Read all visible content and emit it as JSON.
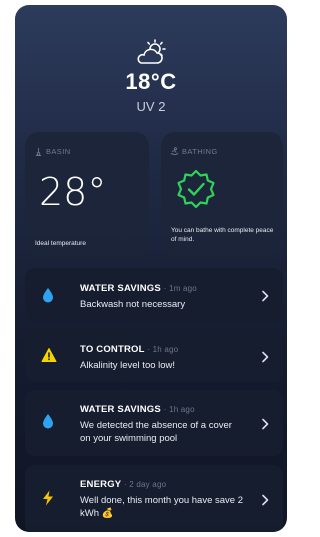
{
  "weather": {
    "icon": "partly-sunny-icon",
    "temperature": "18°C",
    "uv": "UV 2"
  },
  "basin": {
    "label": "BASIN",
    "icon": "thermometer-icon",
    "temperature": "28°",
    "status": "Ideal temperature"
  },
  "bathing": {
    "label": "BATHING",
    "icon": "swimmer-icon",
    "status_icon": "check-badge-icon",
    "message": "You can bathe with complete peace of mind."
  },
  "notifications": [
    {
      "icon": "water-drop-icon",
      "title": "WATER SAVINGS",
      "time": "1m ago",
      "body": "Backwash not necessary"
    },
    {
      "icon": "warning-icon",
      "title": "TO CONTROL",
      "time": "1h ago",
      "body": "Alkalinity level too low!"
    },
    {
      "icon": "water-drop-icon",
      "title": "WATER SAVINGS",
      "time": "1h ago",
      "body": "We detected the absence of a cover on your swimming pool"
    },
    {
      "icon": "lightning-icon",
      "title": "ENERGY",
      "time": "2 day ago",
      "body": "Well done, this month you have save 2 kWh 💰"
    }
  ],
  "colors": {
    "accent_green": "#2fd35a",
    "warning_yellow": "#f5d400",
    "drop_blue": "#2fa3f2",
    "bolt_yellow": "#f7c600"
  }
}
